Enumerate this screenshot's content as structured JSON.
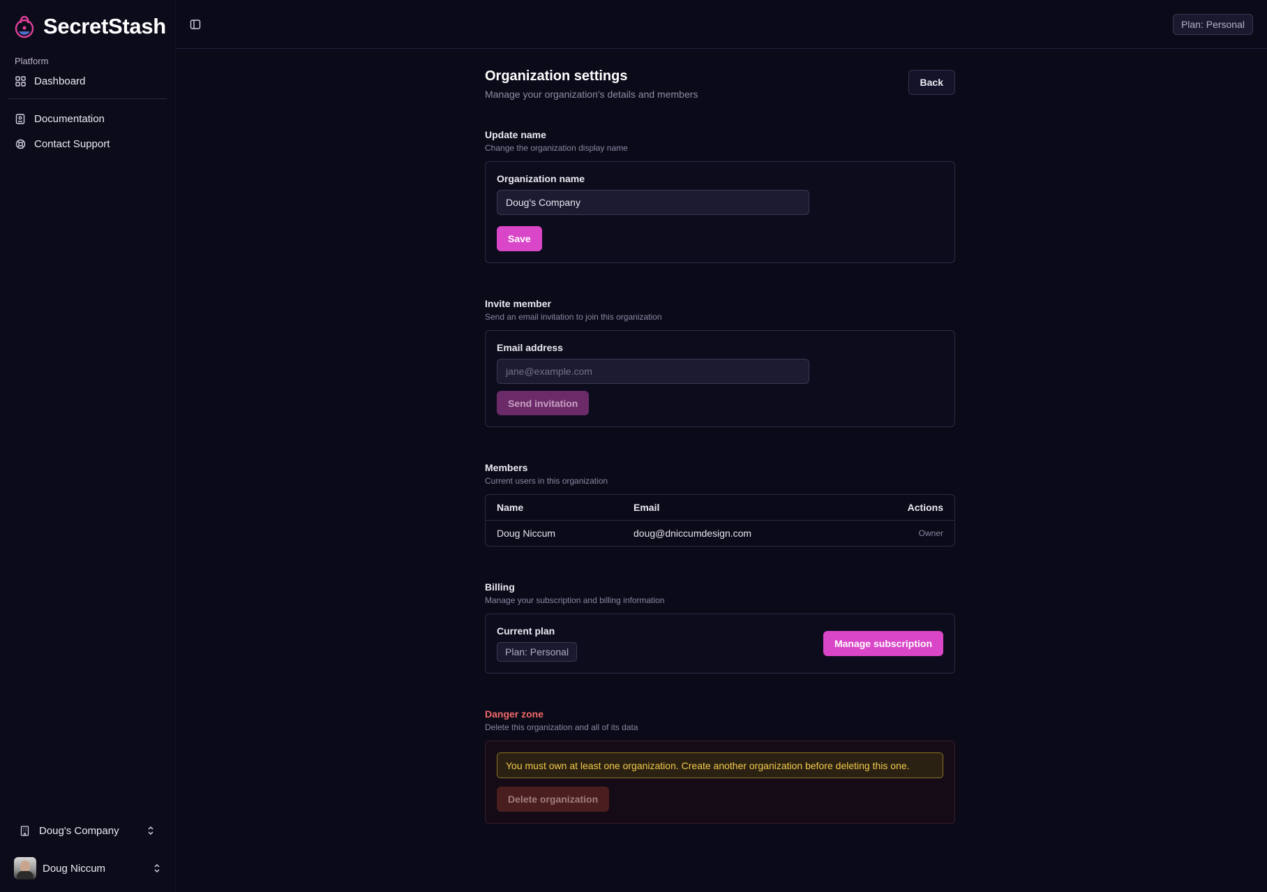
{
  "brand": {
    "name": "SecretStash"
  },
  "sidebar": {
    "group_label": "Platform",
    "items": [
      {
        "label": "Dashboard",
        "icon": "grid-icon"
      }
    ],
    "secondary_items": [
      {
        "label": "Documentation",
        "icon": "book-icon"
      },
      {
        "label": "Contact Support",
        "icon": "lifebuoy-icon"
      }
    ],
    "org_switcher": {
      "label": "Doug's Company",
      "icon": "building-icon"
    },
    "user": {
      "name": "Doug Niccum"
    }
  },
  "topbar": {
    "plan_badge": "Plan: Personal"
  },
  "page": {
    "title": "Organization settings",
    "subtitle": "Manage your organization's details and members",
    "back_label": "Back"
  },
  "update_name": {
    "title": "Update name",
    "subtitle": "Change the organization display name",
    "field_label": "Organization name",
    "value": "Doug's Company",
    "save_label": "Save"
  },
  "invite": {
    "title": "Invite member",
    "subtitle": "Send an email invitation to join this organization",
    "field_label": "Email address",
    "placeholder": "jane@example.com",
    "send_label": "Send invitation"
  },
  "members": {
    "title": "Members",
    "subtitle": "Current users in this organization",
    "columns": [
      "Name",
      "Email",
      "Actions"
    ],
    "rows": [
      {
        "name": "Doug Niccum",
        "email": "doug@dniccumdesign.com",
        "action": "Owner"
      }
    ]
  },
  "billing": {
    "title": "Billing",
    "subtitle": "Manage your subscription and billing information",
    "current_plan_label": "Current plan",
    "plan": "Plan: Personal",
    "manage_label": "Manage subscription"
  },
  "danger": {
    "title": "Danger zone",
    "subtitle": "Delete this organization and all of its data",
    "warning": "You must own at least one organization. Create another organization before deleting this one.",
    "delete_label": "Delete organization"
  },
  "colors": {
    "accent": "#d946c7",
    "background": "#0b0a19",
    "danger": "#f06a6a",
    "warning": "#f2c94c"
  }
}
